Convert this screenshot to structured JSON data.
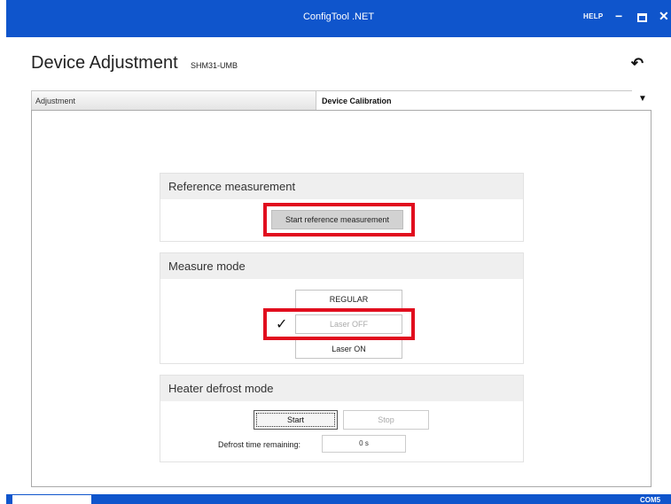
{
  "window": {
    "title": "ConfigTool .NET",
    "help_label": "HELP",
    "minimize_symbol": "−",
    "close_symbol": "✕"
  },
  "page": {
    "title": "Device Adjustment",
    "device": "SHM31-UMB",
    "undo_symbol": "↶"
  },
  "tabs": {
    "adjustment": "Adjustment",
    "calibration": "Device Calibration",
    "dropdown_symbol": "▼"
  },
  "reference": {
    "title": "Reference measurement",
    "start_button": "Start reference measurement"
  },
  "measure_mode": {
    "title": "Measure mode",
    "options": [
      "REGULAR",
      "Laser OFF",
      "Laser ON"
    ],
    "selected_mark": "✓"
  },
  "heater": {
    "title": "Heater defrost mode",
    "start_button": "Start",
    "stop_button": "Stop",
    "remaining_label": "Defrost time remaining:",
    "remaining_value": "0 s"
  },
  "status": {
    "port": "COM5"
  },
  "colors": {
    "titlebar": "#0f55cc",
    "highlight": "#e10e1e"
  }
}
